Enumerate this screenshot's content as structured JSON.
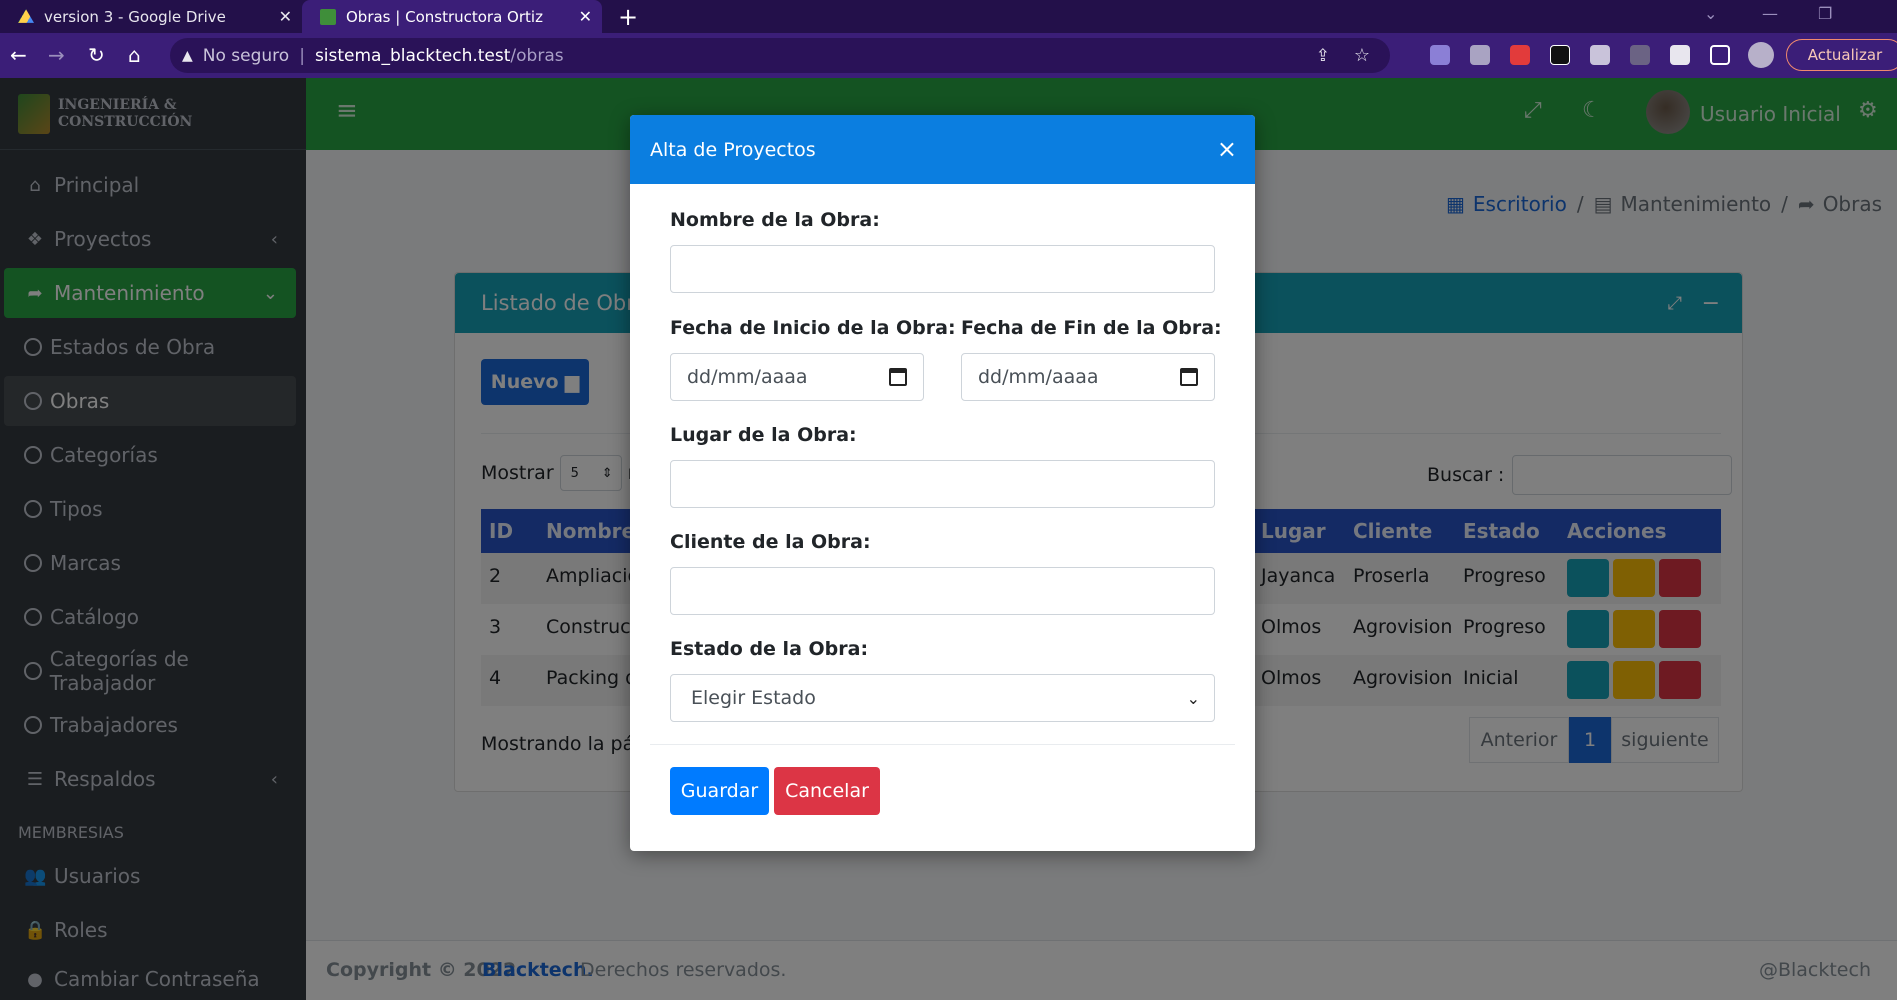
{
  "browser": {
    "tabs": [
      {
        "title": "version 3 - Google Drive",
        "active": false
      },
      {
        "title": "Obras | Constructora Ortiz",
        "active": true
      }
    ],
    "url_security": "No seguro",
    "url_host": "sistema_blacktech.test",
    "url_path": "/obras",
    "update_label": "Actualizar"
  },
  "brand": {
    "line1": "INGENIERÍA &",
    "line2": "CONSTRUCCIÓN"
  },
  "sidebar": {
    "items": [
      {
        "label": "Principal",
        "icon": "home-icon"
      },
      {
        "label": "Proyectos",
        "icon": "cubes-icon"
      },
      {
        "label": "Mantenimiento",
        "icon": "share-icon"
      },
      {
        "label": "Estados de Obra"
      },
      {
        "label": "Obras"
      },
      {
        "label": "Categorías"
      },
      {
        "label": "Tipos"
      },
      {
        "label": "Marcas"
      },
      {
        "label": "Catálogo"
      },
      {
        "label": "Categorías de Trabajador"
      },
      {
        "label": "Trabajadores"
      },
      {
        "label": "Respaldos",
        "icon": "database-icon"
      }
    ],
    "section_header": "MEMBRESIAS",
    "membership_items": [
      {
        "label": "Usuarios",
        "icon": "users-icon"
      },
      {
        "label": "Roles",
        "icon": "user-lock-icon"
      },
      {
        "label": "Cambiar Contraseña",
        "icon": "user-icon"
      }
    ]
  },
  "topbar": {
    "user_name": "Usuario Inicial"
  },
  "breadcrumb": {
    "items": [
      "Escritorio",
      "Mantenimiento",
      "Obras"
    ],
    "separator": "/"
  },
  "card": {
    "title": "Listado de Obras",
    "new_button": "Nuevo",
    "show_label": "Mostrar",
    "show_value": "5",
    "show_suffix": "re",
    "search_label": "Buscar :",
    "columns": [
      "ID",
      "Nombre",
      "Lugar",
      "Cliente",
      "Estado",
      "Acciones"
    ],
    "rows": [
      {
        "id": "2",
        "nombre": "Ampliacio",
        "lugar": "Jayanca",
        "cliente": "Proserla",
        "estado": "Progreso"
      },
      {
        "id": "3",
        "nombre": "Construcc",
        "lugar": "Olmos",
        "cliente": "Agrovision",
        "estado": "Progreso"
      },
      {
        "id": "4",
        "nombre": "Packing de",
        "lugar": "Olmos",
        "cliente": "Agrovision",
        "estado": "Inicial"
      }
    ],
    "info_text": "Mostrando la pági",
    "pagination": {
      "prev": "Anterior",
      "current": "1",
      "next": "siguiente"
    }
  },
  "modal": {
    "title": "Alta de Proyectos",
    "close": "×",
    "nombre_label": "Nombre de la Obra:",
    "nombre_value": "",
    "fecha_inicio_label": "Fecha de Inicio de la Obra:",
    "fecha_inicio_placeholder": "dd/mm/aaaa",
    "fecha_fin_label": "Fecha de Fin de la Obra:",
    "fecha_fin_placeholder": "dd/mm/aaaa",
    "lugar_label": "Lugar de la Obra:",
    "lugar_value": "",
    "cliente_label": "Cliente de la Obra:",
    "cliente_value": "",
    "estado_label": "Estado de la Obra:",
    "estado_selected": "Elegir Estado",
    "save_button": "Guardar",
    "cancel_button": "Cancelar"
  },
  "footer": {
    "copyright_prefix": "Copyright © 2022",
    "company": "Blacktech.",
    "rights": "Derechos reservados.",
    "handle": "@Blacktech"
  },
  "colors": {
    "sidebar_bg": "#343a40",
    "topbar_green": "#28a745",
    "card_header": "#17a2b8",
    "table_header": "#2954c9",
    "modal_header": "#0b7ee0",
    "save": "#007bff",
    "cancel": "#dc3545",
    "view": "#17a2b8",
    "edit": "#ffc107",
    "delete": "#dc3545"
  }
}
